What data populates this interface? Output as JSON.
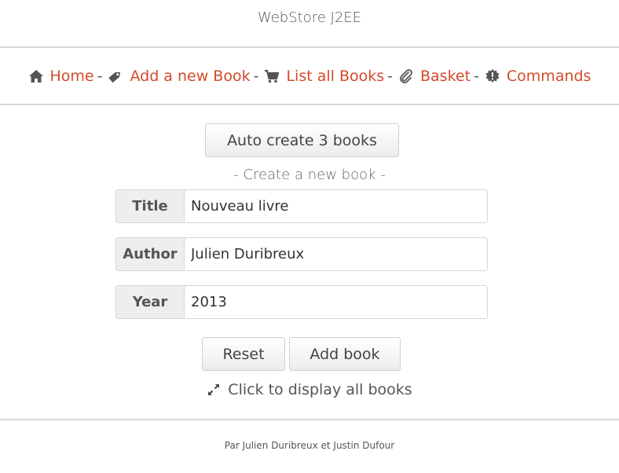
{
  "header": {
    "site_title": "WebStore J2EE"
  },
  "nav": {
    "separator": "-",
    "items": [
      {
        "label": "Home",
        "icon": "home-icon"
      },
      {
        "label": "Add a new Book",
        "icon": "tag-icon"
      },
      {
        "label": "List all Books",
        "icon": "shopping-cart-icon"
      },
      {
        "label": "Basket",
        "icon": "paperclip-icon"
      },
      {
        "label": "Commands",
        "icon": "certificate-icon"
      }
    ]
  },
  "main": {
    "auto_create_label": "Auto create 3 books",
    "form_caption": "- Create a new book -",
    "fields": {
      "title": {
        "label": "Title",
        "value": "Nouveau livre"
      },
      "author": {
        "label": "Author",
        "value": "Julien Duribreux"
      },
      "year": {
        "label": "Year",
        "value": "2013"
      }
    },
    "reset_label": "Reset",
    "add_book_label": "Add book",
    "display_all_label": "Click to display all books",
    "display_all_icon": "expand-icon"
  },
  "footer": {
    "text": "Par Julien Duribreux et Justin Dufour"
  },
  "colors": {
    "link": "#d34a2a",
    "text": "#555555",
    "rule": "#d6d6d6"
  }
}
